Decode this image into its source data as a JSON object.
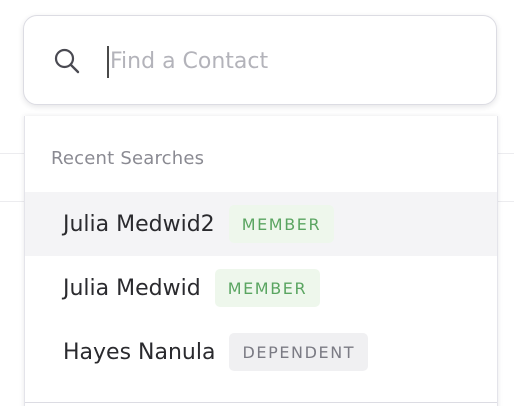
{
  "search": {
    "placeholder": "Find a Contact",
    "value": "",
    "icon": "search-icon"
  },
  "dropdown": {
    "section_title": "Recent Searches",
    "results": [
      {
        "name": "Julia Medwid2",
        "badge": "MEMBER",
        "badge_type": "member",
        "highlighted": true
      },
      {
        "name": "Julia Medwid",
        "badge": "MEMBER",
        "badge_type": "member",
        "highlighted": false
      },
      {
        "name": "Hayes Nanula",
        "badge": "DEPENDENT",
        "badge_type": "dependent",
        "highlighted": false
      }
    ]
  },
  "colors": {
    "member_badge_bg": "#eef7ec",
    "member_badge_text": "#5aa561",
    "dependent_badge_bg": "#f0f0f2",
    "dependent_badge_text": "#7b7b84",
    "highlight_row_bg": "#f4f4f6"
  }
}
